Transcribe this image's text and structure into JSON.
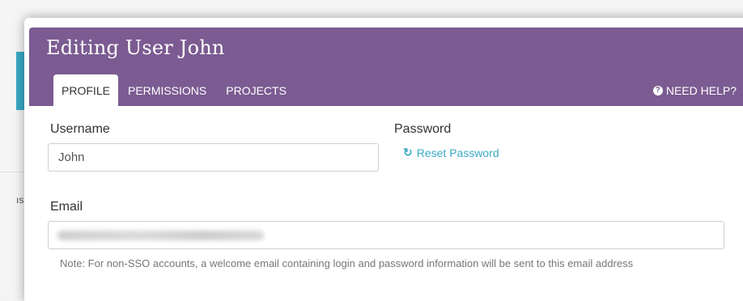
{
  "modal": {
    "title": "Editing User John",
    "tabs": [
      {
        "label": "PROFILE",
        "active": true
      },
      {
        "label": "PERMISSIONS",
        "active": false
      },
      {
        "label": "PROJECTS",
        "active": false
      }
    ],
    "help_label": "NEED HELP?",
    "help_icon": "question-circle-icon"
  },
  "form": {
    "username": {
      "label": "Username",
      "value": "John"
    },
    "password": {
      "label": "Password",
      "reset_label": "Reset Password",
      "reset_icon": "refresh-icon"
    },
    "email": {
      "label": "Email",
      "value_blurred": true
    },
    "note": "Note: For non-SSO accounts, a welcome email containing login and password information will be sent to this email address"
  },
  "background": {
    "fragment": "ıs"
  },
  "colors": {
    "header": "#7b5b91",
    "link": "#3aa9c4",
    "text": "#333333",
    "muted": "#777777"
  }
}
